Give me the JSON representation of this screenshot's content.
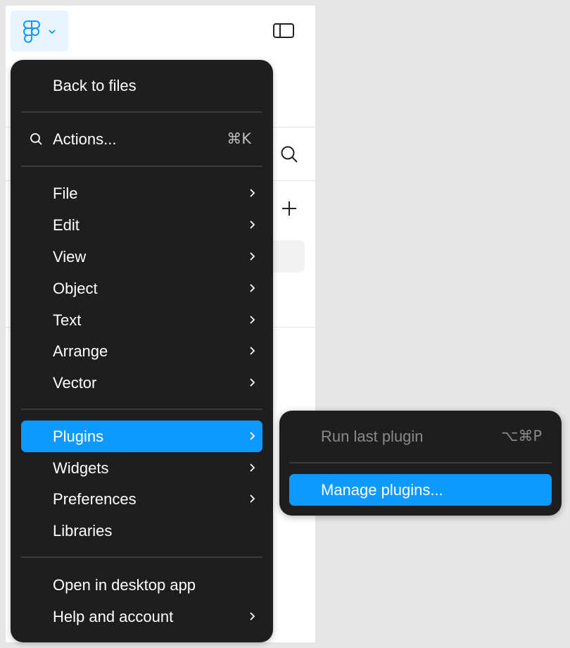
{
  "menu": {
    "back": "Back to files",
    "actions": {
      "label": "Actions...",
      "shortcut": "⌘K"
    },
    "items": {
      "file": "File",
      "edit": "Edit",
      "view": "View",
      "object": "Object",
      "text": "Text",
      "arrange": "Arrange",
      "vector": "Vector",
      "plugins": "Plugins",
      "widgets": "Widgets",
      "preferences": "Preferences",
      "libraries": "Libraries",
      "open_desktop": "Open in desktop app",
      "help": "Help and account"
    }
  },
  "submenu": {
    "run_last": {
      "label": "Run last plugin",
      "shortcut": "⌥⌘P"
    },
    "manage": "Manage plugins..."
  },
  "colors": {
    "menu_bg": "#1e1e1e",
    "accent": "#0d99ff",
    "logo_button_bg": "#e5f4ff"
  },
  "icons": [
    "figma-logo-icon",
    "chevron-down-icon",
    "sidebar-toggle-icon",
    "search-icon",
    "plus-icon",
    "chevron-right-icon"
  ]
}
